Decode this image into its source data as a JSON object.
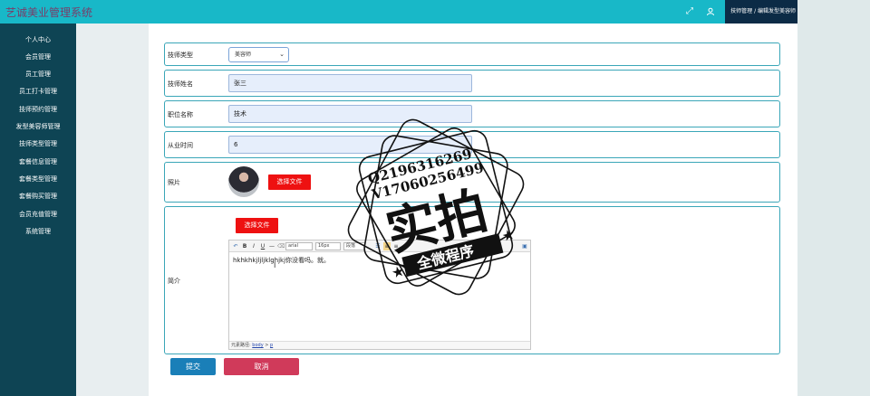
{
  "app": {
    "title": "艺诚美业管理系统"
  },
  "header": {
    "fullscreen_icon": "fullscreen-icon",
    "user_icon": "user-icon",
    "breadcrumb": "技师管理 / 编辑发型美容师"
  },
  "sidebar": {
    "items": [
      {
        "label": "个人中心"
      },
      {
        "label": "会员管理"
      },
      {
        "label": "员工管理"
      },
      {
        "label": "员工打卡管理"
      },
      {
        "label": "技师预约管理"
      },
      {
        "label": "发型美容师管理"
      },
      {
        "label": "技师类型管理"
      },
      {
        "label": "套餐信息管理"
      },
      {
        "label": "套餐类型管理"
      },
      {
        "label": "套餐购买管理"
      },
      {
        "label": "会员充值管理"
      },
      {
        "label": "系统管理"
      }
    ]
  },
  "form": {
    "type": {
      "label": "技师类型",
      "value": "美容师"
    },
    "name": {
      "label": "技师姓名",
      "value": "张三"
    },
    "position": {
      "label": "职位名称",
      "value": "技术"
    },
    "years": {
      "label": "从业时间",
      "value": "6"
    },
    "photo": {
      "label": "照片",
      "choose_file": "选择文件"
    },
    "intro": {
      "label": "简介",
      "choose_file": "选择文件",
      "toolbar": {
        "font": "arial",
        "size": "16px",
        "block": "段落"
      },
      "content": "hkhkhkjljljklghjkj你没看吗。就。",
      "status_prefix": "元素路径:",
      "status_path_body": "body",
      "status_sep": ">",
      "status_path_p": "p"
    },
    "submit": "提交",
    "cancel": "取消"
  },
  "watermark": {
    "line1": "Q2196316269",
    "line2": "V17060256499",
    "main": "实拍",
    "banner": "全微程序"
  },
  "colors": {
    "topbar": "#18b8c8",
    "sidebar": "#0e4454",
    "submit": "#1a7fb8",
    "cancel": "#d03a5a",
    "file_button": "#ee1111",
    "row_border": "#3aa6b8"
  }
}
